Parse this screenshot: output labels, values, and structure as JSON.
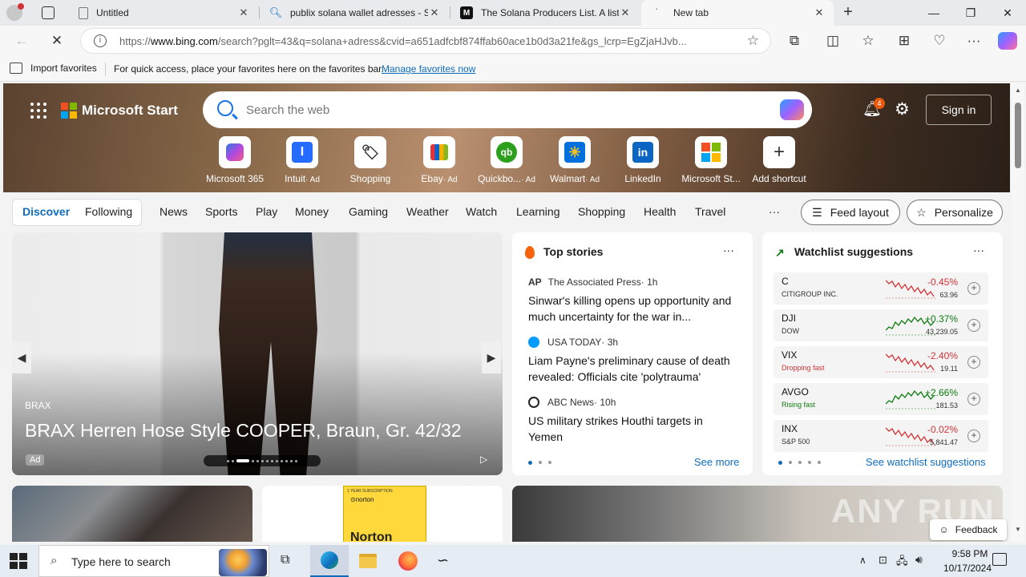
{
  "tabs": [
    {
      "title": "Untitled",
      "icon": "page-icon"
    },
    {
      "title": "publix solana wallet adresses - Se",
      "icon": "search-icon"
    },
    {
      "title": "The Solana Producers List. A list o",
      "icon": "medium-icon"
    },
    {
      "title": "New tab",
      "icon": "loading-icon"
    }
  ],
  "address": {
    "prefix": "https://",
    "host": "www.bing.com",
    "path": "/search?pglt=43&q=solana+adress&cvid=a651adfcbf874ffab60ace1b0d3a21fe&gs_lcrp=EgZjaHJvb..."
  },
  "favbar": {
    "import_label": "Import favorites",
    "hint": "For quick access, place your favorites here on the favorites bar.",
    "manage_link": "Manage favorites now"
  },
  "header": {
    "brand": "Microsoft Start",
    "search_placeholder": "Search the web",
    "notif_count": "4",
    "sign_in": "Sign in"
  },
  "shortcuts": [
    {
      "label": "Microsoft 365",
      "icon": "microsoft365-icon"
    },
    {
      "label": "Intuit",
      "ad": "· Ad",
      "icon": "intuit-icon"
    },
    {
      "label": "Shopping",
      "icon": "shopping-tag-icon"
    },
    {
      "label": "Ebay",
      "ad": "· Ad",
      "icon": "ebay-bag-icon"
    },
    {
      "label": "Quickbo...",
      "ad": "· Ad",
      "icon": "quickbooks-icon"
    },
    {
      "label": "Walmart",
      "ad": "· Ad",
      "icon": "walmart-icon"
    },
    {
      "label": "LinkedIn",
      "icon": "linkedin-icon"
    },
    {
      "label": "Microsoft St...",
      "icon": "microsoft-store-icon"
    },
    {
      "label": "Add shortcut",
      "icon": "plus-icon"
    }
  ],
  "feed_tabs": {
    "discover": "Discover",
    "following": "Following",
    "categories": [
      "News",
      "Sports",
      "Play",
      "Money",
      "Gaming",
      "Weather",
      "Watch",
      "Learning",
      "Shopping",
      "Health",
      "Travel"
    ],
    "more": "···",
    "feed_layout": "Feed layout",
    "personalize": "Personalize"
  },
  "ad_card": {
    "brand": "BRAX",
    "title": "BRAX Herren Hose Style COOPER, Braun, Gr. 42/32",
    "ad_badge": "Ad"
  },
  "top_stories": {
    "title": "Top stories",
    "more": "···",
    "items": [
      {
        "source": "The Associated Press",
        "age": " · 1h",
        "headline": "Sinwar's killing opens up opportunity and much uncertainty for the war in..."
      },
      {
        "source": "USA TODAY",
        "age": " · 3h",
        "headline": "Liam Payne's preliminary cause of death revealed: Officials cite 'polytrauma'"
      },
      {
        "source": "ABC News",
        "age": " · 10h",
        "headline": "US military strikes Houthi targets in Yemen"
      }
    ],
    "see_more": "See more"
  },
  "watchlist": {
    "title": "Watchlist suggestions",
    "more": "···",
    "items": [
      {
        "symbol": "C",
        "name": "CITIGROUP INC.",
        "change": "-0.45%",
        "price": "63.96",
        "dir": "down"
      },
      {
        "symbol": "DJI",
        "name": "DOW",
        "change": "+0.37%",
        "price": "43,239.05",
        "dir": "up"
      },
      {
        "symbol": "VIX",
        "name": "Dropping fast",
        "change": "-2.40%",
        "price": "19.11",
        "dir": "down"
      },
      {
        "symbol": "AVGO",
        "name": "Rising fast",
        "change": "+2.66%",
        "price": "181.53",
        "dir": "up"
      },
      {
        "symbol": "INX",
        "name": "S&P 500",
        "change": "-0.02%",
        "price": "5,841.47",
        "dir": "down"
      }
    ],
    "see_link": "See watchlist suggestions"
  },
  "product_card": {
    "box_label": "Norton",
    "subscription": "1 YEAR SUBSCRIPTION"
  },
  "watermark": "ANY RUN",
  "feedback": "Feedback",
  "taskbar": {
    "search_placeholder": "Type here to search",
    "time": "9:58 PM",
    "date": "10/17/2024"
  },
  "colors": {
    "accent": "#0f6cbd",
    "down": "#d13438",
    "up": "#107c10"
  }
}
